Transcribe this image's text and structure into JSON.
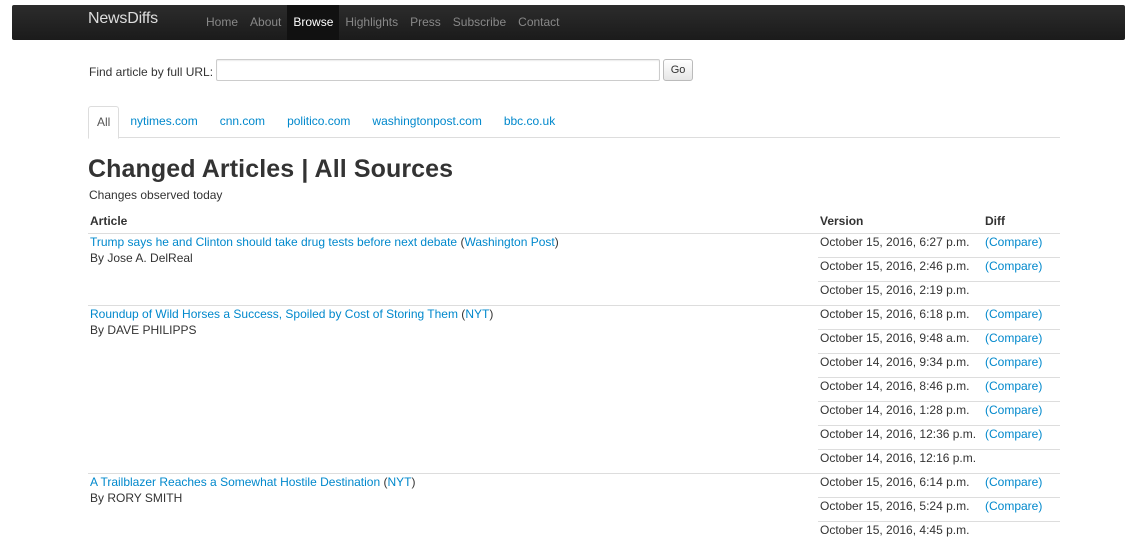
{
  "navbar": {
    "brand": "NewsDiffs",
    "links": [
      "Home",
      "About",
      "Browse",
      "Highlights",
      "Press",
      "Subscribe",
      "Contact"
    ]
  },
  "search": {
    "label": "Find article by full URL:",
    "value": "",
    "placeholder": "",
    "button": "Go"
  },
  "tabs": [
    "All",
    "nytimes.com",
    "cnn.com",
    "politico.com",
    "washingtonpost.com",
    "bbc.co.uk"
  ],
  "page": {
    "title": "Changed Articles | All Sources",
    "subtitle": "Changes observed today"
  },
  "table": {
    "headers": [
      "Article",
      "Version",
      "Diff"
    ],
    "compare_label": "(Compare)",
    "articles": [
      {
        "title": "Trump says he and Clinton should take drug tests before next debate",
        "source": "Washington Post",
        "byline": "By Jose A. DelReal",
        "versions": [
          {
            "date": "October 15, 2016, 6:27 p.m.",
            "compare": true
          },
          {
            "date": "October 15, 2016, 2:46 p.m.",
            "compare": true
          },
          {
            "date": "October 15, 2016, 2:19 p.m.",
            "compare": false
          }
        ]
      },
      {
        "title": "Roundup of Wild Horses a Success, Spoiled by Cost of Storing Them",
        "source": "NYT",
        "byline": "By DAVE PHILIPPS",
        "versions": [
          {
            "date": "October 15, 2016, 6:18 p.m.",
            "compare": true
          },
          {
            "date": "October 15, 2016, 9:48 a.m.",
            "compare": true
          },
          {
            "date": "October 14, 2016, 9:34 p.m.",
            "compare": true
          },
          {
            "date": "October 14, 2016, 8:46 p.m.",
            "compare": true
          },
          {
            "date": "October 14, 2016, 1:28 p.m.",
            "compare": true
          },
          {
            "date": "October 14, 2016, 12:36 p.m.",
            "compare": true
          },
          {
            "date": "October 14, 2016, 12:16 p.m.",
            "compare": false
          }
        ]
      },
      {
        "title": "A Trailblazer Reaches a Somewhat Hostile Destination",
        "source": "NYT",
        "byline": "By RORY SMITH",
        "versions": [
          {
            "date": "October 15, 2016, 6:14 p.m.",
            "compare": true
          },
          {
            "date": "October 15, 2016, 5:24 p.m.",
            "compare": true
          },
          {
            "date": "October 15, 2016, 4:45 p.m.",
            "compare": false
          }
        ]
      }
    ]
  }
}
